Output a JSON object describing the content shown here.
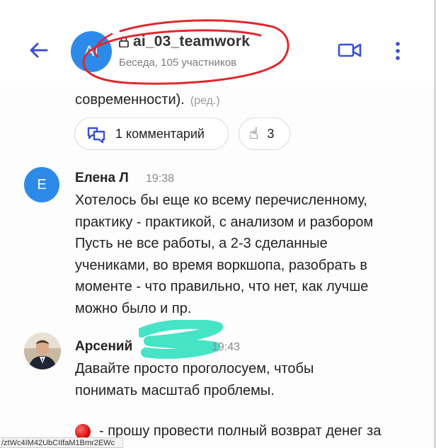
{
  "header": {
    "avatar_initials": "AI",
    "title": "ai_03_teamwork",
    "subtitle": "Беседа, 105 участников",
    "accent_color": "#3a4fd8"
  },
  "messages": {
    "previous": {
      "text_tail": "современности).",
      "edited_label": "(ред.)",
      "comment_chip_label": "1 комментарий",
      "reaction_emoji": "☝",
      "reaction_count": "3"
    },
    "elena": {
      "avatar_initial": "E",
      "author": "Елена Л",
      "time": "19:38",
      "body": "Хотелось бы еще ко всему перечисленному,\nпрактику - практикой, с анализом и разбором\nПусть не все работы, а 2-3 сделанные\nучениками, во время воркшопа, разобрать в\nмоменте  - что правильно, что нет, как лучше\nможно было и пр."
    },
    "arseniy": {
      "author": "Арсений",
      "time": "19:43",
      "body": "Давайте просто проголосуем, чтобы\nпонимать масштаб проблемы.",
      "poll_option_text": "- прошу провести полный возврат денег за"
    }
  },
  "status_bar": {
    "url_fragment": "/ztWc4IM42UbCIIfaM1Bmr2EWc"
  }
}
